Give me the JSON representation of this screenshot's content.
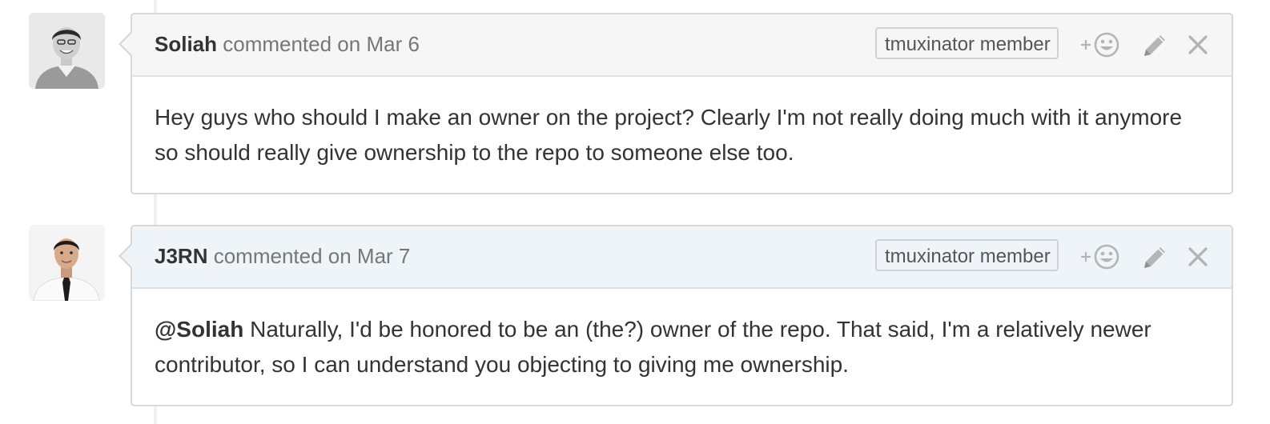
{
  "comments": [
    {
      "author": "Soliah",
      "action_text": " commented on Mar 6",
      "role": "tmuxinator member",
      "body": "Hey guys who should I make an owner on the project? Clearly I'm not really doing much with it anymore so should really give ownership to the repo to someone else too."
    },
    {
      "author": "J3RN",
      "action_text": " commented on Mar 7",
      "role": "tmuxinator member",
      "mention": "@Soliah",
      "body": " Naturally, I'd be honored to be an (the?) owner of the repo. That said, I'm a relatively newer contributor, so I can understand you objecting to giving me ownership."
    }
  ],
  "icons": {
    "add_reaction": "smiley-plus-icon",
    "edit": "pencil-icon",
    "delete": "close-icon"
  },
  "colors": {
    "header_default": "#f6f6f6",
    "header_highlight": "#eef4f8",
    "border": "#d8d8d8",
    "muted_text": "#767676",
    "icon_gray": "#b5b5b5"
  }
}
